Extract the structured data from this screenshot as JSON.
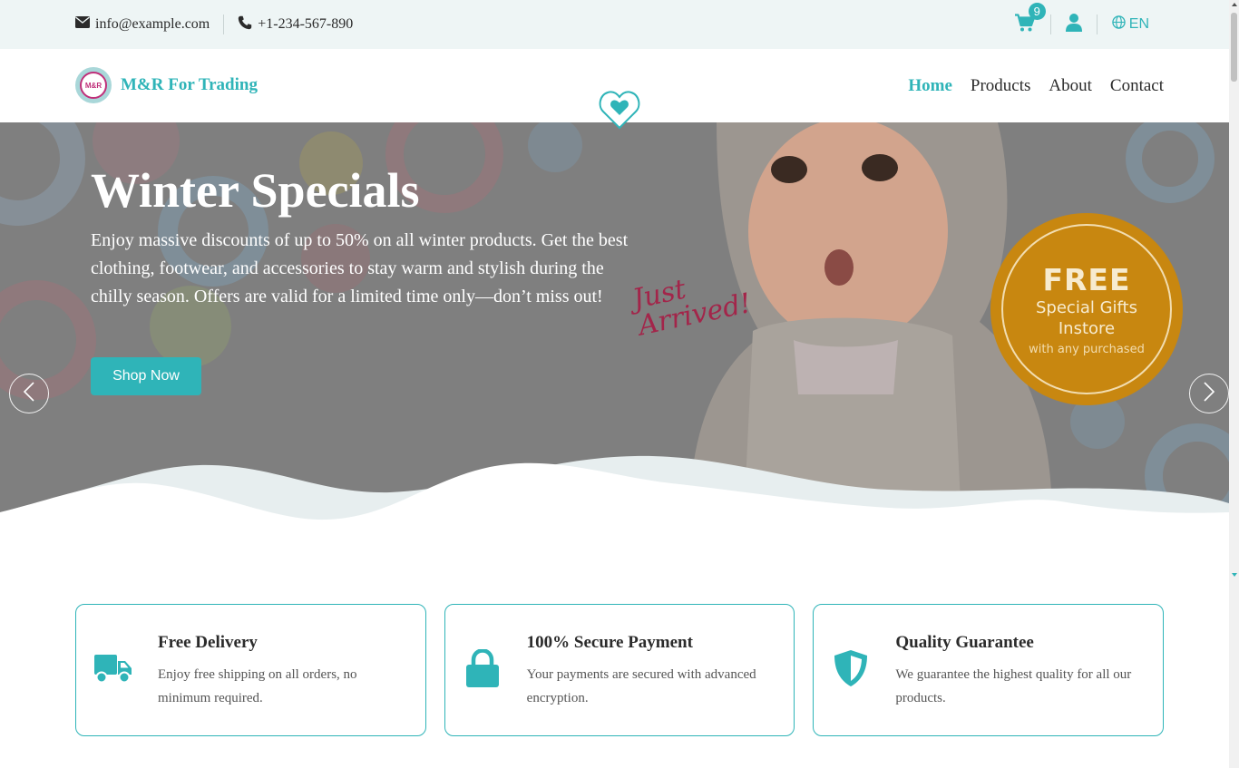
{
  "topbar": {
    "email": "info@example.com",
    "phone": "+1-234-567-890",
    "cart_count": "9",
    "language": "EN"
  },
  "header": {
    "brand_name": "M&R For Trading",
    "logo_text": "M&R",
    "nav": [
      {
        "label": "Home",
        "active": true
      },
      {
        "label": "Products",
        "active": false
      },
      {
        "label": "About",
        "active": false
      },
      {
        "label": "Contact",
        "active": false
      }
    ]
  },
  "hero": {
    "title": "Winter Specials",
    "text": "Enjoy massive discounts of up to 50% on all winter products. Get the best clothing, footwear, and accessories to stay warm and stylish during the chilly season. Offers are valid for a limited time only—don’t miss out!",
    "button": "Shop Now",
    "badge": {
      "big": "FREE",
      "line1": "Special Gifts",
      "line2": "Instore",
      "small": "with any purchased"
    },
    "script_line1": "Just",
    "script_line2": "Arrived!"
  },
  "features": [
    {
      "icon": "truck-icon",
      "title": "Free Delivery",
      "desc": "Enjoy free shipping on all orders, no minimum required."
    },
    {
      "icon": "lock-icon",
      "title": "100% Secure Payment",
      "desc": "Your payments are secured with advanced encryption."
    },
    {
      "icon": "shield-icon",
      "title": "Quality Guarantee",
      "desc": "We guarantee the highest quality for all our products."
    }
  ],
  "colors": {
    "accent": "#2fb4b8",
    "topbar_bg": "#eef5f5",
    "badge_orange": "#c88710"
  }
}
